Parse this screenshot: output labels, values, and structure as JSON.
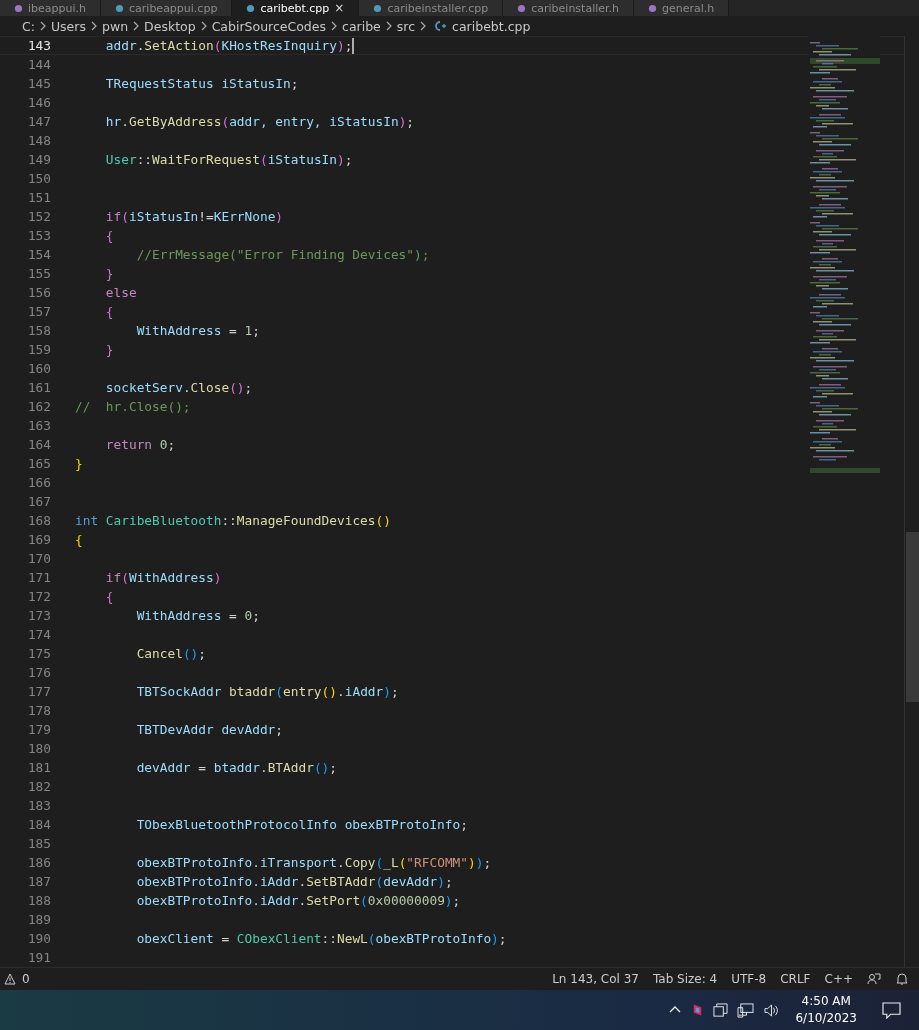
{
  "tabs": [
    {
      "label": "ibeappui.h",
      "selected": false,
      "kind": "header"
    },
    {
      "label": "caribeappui.cpp",
      "selected": false,
      "kind": "cpp"
    },
    {
      "label": "caribebt.cpp",
      "selected": true,
      "kind": "cpp",
      "close": "×"
    },
    {
      "label": "caribeinstaller.cpp",
      "selected": false,
      "kind": "cpp"
    },
    {
      "label": "caribeinstaller.h",
      "selected": false,
      "kind": "header"
    },
    {
      "label": "general.h",
      "selected": false,
      "kind": "header"
    }
  ],
  "breadcrumb": [
    "C:",
    "Users",
    "pwn",
    "Desktop",
    "CabirSourceCodes",
    "caribe",
    "src",
    "caribebt.cpp"
  ],
  "lines": [
    {
      "number": "143",
      "current": true,
      "tokens": [
        {
          "kind": "variable",
          "text": "    addr"
        },
        {
          "kind": "plain",
          "text": "."
        },
        {
          "kind": "function",
          "text": "SetAction"
        },
        {
          "kind": "bracket2",
          "text": "("
        },
        {
          "kind": "variable",
          "text": "KHostResInquiry"
        },
        {
          "kind": "bracket2",
          "text": ")"
        },
        {
          "kind": "plain",
          "text": ";"
        }
      ]
    },
    {
      "number": "144",
      "current": false
    },
    {
      "number": "145",
      "current": false,
      "tokens": [
        {
          "kind": "variable",
          "text": "    TRequestStatus iStatusIn"
        },
        {
          "kind": "plain",
          "text": ";"
        }
      ]
    },
    {
      "number": "146",
      "current": false
    },
    {
      "number": "147",
      "current": false,
      "tokens": [
        {
          "kind": "variable",
          "text": "    hr"
        },
        {
          "kind": "plain",
          "text": "."
        },
        {
          "kind": "function",
          "text": "GetByAddress"
        },
        {
          "kind": "bracket2",
          "text": "("
        },
        {
          "kind": "variable",
          "text": "addr, entry, iStatusIn"
        },
        {
          "kind": "bracket2",
          "text": ")"
        },
        {
          "kind": "plain",
          "text": ";"
        }
      ]
    },
    {
      "number": "148",
      "current": false
    },
    {
      "number": "149",
      "current": false,
      "tokens": [
        {
          "kind": "type",
          "text": "    User"
        },
        {
          "kind": "plain",
          "text": "::"
        },
        {
          "kind": "function",
          "text": "WaitForRequest"
        },
        {
          "kind": "bracket2",
          "text": "("
        },
        {
          "kind": "variable",
          "text": "iStatusIn"
        },
        {
          "kind": "bracket2",
          "text": ")"
        },
        {
          "kind": "plain",
          "text": ";"
        }
      ]
    },
    {
      "number": "150",
      "current": false
    },
    {
      "number": "151",
      "current": false
    },
    {
      "number": "152",
      "current": false,
      "tokens": [
        {
          "kind": "control",
          "text": "    if"
        },
        {
          "kind": "bracket2",
          "text": "("
        },
        {
          "kind": "variable",
          "text": "iStatusIn"
        },
        {
          "kind": "plain",
          "text": "!="
        },
        {
          "kind": "variable",
          "text": "KErrNone"
        },
        {
          "kind": "bracket2",
          "text": ")"
        }
      ]
    },
    {
      "number": "153",
      "current": false,
      "tokens": [
        {
          "kind": "bracket2",
          "text": "    {"
        }
      ]
    },
    {
      "number": "154",
      "current": false,
      "tokens": [
        {
          "kind": "comment",
          "text": "        //ErrMessage(\"Error Finding Devices\");"
        }
      ]
    },
    {
      "number": "155",
      "current": false,
      "tokens": [
        {
          "kind": "bracket2",
          "text": "    }"
        }
      ]
    },
    {
      "number": "156",
      "current": false,
      "tokens": [
        {
          "kind": "control",
          "text": "    else"
        }
      ]
    },
    {
      "number": "157",
      "current": false,
      "tokens": [
        {
          "kind": "bracket2",
          "text": "    {"
        }
      ]
    },
    {
      "number": "158",
      "current": false,
      "tokens": [
        {
          "kind": "variable",
          "text": "        WithAddress"
        },
        {
          "kind": "plain",
          "text": " = "
        },
        {
          "kind": "number",
          "text": "1"
        },
        {
          "kind": "plain",
          "text": ";"
        }
      ]
    },
    {
      "number": "159",
      "current": false,
      "tokens": [
        {
          "kind": "bracket2",
          "text": "    }"
        }
      ]
    },
    {
      "number": "160",
      "current": false
    },
    {
      "number": "161",
      "current": false,
      "tokens": [
        {
          "kind": "variable",
          "text": "    socketServ"
        },
        {
          "kind": "plain",
          "text": "."
        },
        {
          "kind": "function",
          "text": "Close"
        },
        {
          "kind": "bracket2",
          "text": "()"
        },
        {
          "kind": "plain",
          "text": ";"
        }
      ]
    },
    {
      "number": "162",
      "current": false,
      "tokens": [
        {
          "kind": "comment",
          "text": "//  hr.Close();"
        }
      ]
    },
    {
      "number": "163",
      "current": false
    },
    {
      "number": "164",
      "current": false,
      "tokens": [
        {
          "kind": "control",
          "text": "    return"
        },
        {
          "kind": "number",
          "text": " 0"
        },
        {
          "kind": "plain",
          "text": ";"
        }
      ]
    },
    {
      "number": "165",
      "current": false,
      "tokens": [
        {
          "kind": "bracket1",
          "text": "}"
        }
      ]
    },
    {
      "number": "166",
      "current": false
    },
    {
      "number": "167",
      "current": false
    },
    {
      "number": "168",
      "current": false,
      "tokens": [
        {
          "kind": "keyword",
          "text": "int"
        },
        {
          "kind": "type",
          "text": " CaribeBluetooth"
        },
        {
          "kind": "plain",
          "text": "::"
        },
        {
          "kind": "function",
          "text": "ManageFoundDevices"
        },
        {
          "kind": "bracket1",
          "text": "()"
        }
      ]
    },
    {
      "number": "169",
      "current": false,
      "tokens": [
        {
          "kind": "bracket1",
          "text": "{"
        }
      ]
    },
    {
      "number": "170",
      "current": false
    },
    {
      "number": "171",
      "current": false,
      "tokens": [
        {
          "kind": "control",
          "text": "    if"
        },
        {
          "kind": "bracket2",
          "text": "("
        },
        {
          "kind": "variable",
          "text": "WithAddress"
        },
        {
          "kind": "bracket2",
          "text": ")"
        }
      ]
    },
    {
      "number": "172",
      "current": false,
      "tokens": [
        {
          "kind": "bracket2",
          "text": "    {"
        }
      ]
    },
    {
      "number": "173",
      "current": false,
      "tokens": [
        {
          "kind": "variable",
          "text": "        WithAddress"
        },
        {
          "kind": "plain",
          "text": " = "
        },
        {
          "kind": "number",
          "text": "0"
        },
        {
          "kind": "plain",
          "text": ";"
        }
      ]
    },
    {
      "number": "174",
      "current": false
    },
    {
      "number": "175",
      "current": false,
      "tokens": [
        {
          "kind": "function",
          "text": "        Cancel"
        },
        {
          "kind": "bracket3",
          "text": "()"
        },
        {
          "kind": "plain",
          "text": ";"
        }
      ]
    },
    {
      "number": "176",
      "current": false
    },
    {
      "number": "177",
      "current": false,
      "tokens": [
        {
          "kind": "variable",
          "text": "        TBTSockAddr"
        },
        {
          "kind": "function",
          "text": " btaddr"
        },
        {
          "kind": "bracket3",
          "text": "("
        },
        {
          "kind": "function",
          "text": "entry"
        },
        {
          "kind": "bracket1",
          "text": "()"
        },
        {
          "kind": "plain",
          "text": "."
        },
        {
          "kind": "variable",
          "text": "iAddr"
        },
        {
          "kind": "bracket3",
          "text": ")"
        },
        {
          "kind": "plain",
          "text": ";"
        }
      ]
    },
    {
      "number": "178",
      "current": false
    },
    {
      "number": "179",
      "current": false,
      "tokens": [
        {
          "kind": "variable",
          "text": "        TBTDevAddr devAddr"
        },
        {
          "kind": "plain",
          "text": ";"
        }
      ]
    },
    {
      "number": "180",
      "current": false
    },
    {
      "number": "181",
      "current": false,
      "tokens": [
        {
          "kind": "variable",
          "text": "        devAddr"
        },
        {
          "kind": "plain",
          "text": " = "
        },
        {
          "kind": "variable",
          "text": "btaddr"
        },
        {
          "kind": "plain",
          "text": "."
        },
        {
          "kind": "function",
          "text": "BTAddr"
        },
        {
          "kind": "bracket3",
          "text": "()"
        },
        {
          "kind": "plain",
          "text": ";"
        }
      ]
    },
    {
      "number": "182",
      "current": false
    },
    {
      "number": "183",
      "current": false
    },
    {
      "number": "184",
      "current": false,
      "tokens": [
        {
          "kind": "variable",
          "text": "        TObexBluetoothProtocolInfo obexBTProtoInfo"
        },
        {
          "kind": "plain",
          "text": ";"
        }
      ]
    },
    {
      "number": "185",
      "current": false
    },
    {
      "number": "186",
      "current": false,
      "tokens": [
        {
          "kind": "variable",
          "text": "        obexBTProtoInfo.iTransport"
        },
        {
          "kind": "plain",
          "text": "."
        },
        {
          "kind": "function",
          "text": "Copy"
        },
        {
          "kind": "bracket3",
          "text": "("
        },
        {
          "kind": "function",
          "text": "_L"
        },
        {
          "kind": "bracket1",
          "text": "("
        },
        {
          "kind": "string",
          "text": "\"RFCOMM\""
        },
        {
          "kind": "bracket1",
          "text": ")"
        },
        {
          "kind": "bracket3",
          "text": ")"
        },
        {
          "kind": "plain",
          "text": ";"
        }
      ]
    },
    {
      "number": "187",
      "current": false,
      "tokens": [
        {
          "kind": "variable",
          "text": "        obexBTProtoInfo.iAddr"
        },
        {
          "kind": "plain",
          "text": "."
        },
        {
          "kind": "function",
          "text": "SetBTAddr"
        },
        {
          "kind": "bracket3",
          "text": "("
        },
        {
          "kind": "variable",
          "text": "devAddr"
        },
        {
          "kind": "bracket3",
          "text": ")"
        },
        {
          "kind": "plain",
          "text": ";"
        }
      ]
    },
    {
      "number": "188",
      "current": false,
      "tokens": [
        {
          "kind": "variable",
          "text": "        obexBTProtoInfo.iAddr"
        },
        {
          "kind": "plain",
          "text": "."
        },
        {
          "kind": "function",
          "text": "SetPort"
        },
        {
          "kind": "bracket3",
          "text": "("
        },
        {
          "kind": "number",
          "text": "0x00000009"
        },
        {
          "kind": "bracket3",
          "text": ")"
        },
        {
          "kind": "plain",
          "text": ";"
        }
      ]
    },
    {
      "number": "189",
      "current": false
    },
    {
      "number": "190",
      "current": false,
      "tokens": [
        {
          "kind": "variable",
          "text": "        obexClient"
        },
        {
          "kind": "plain",
          "text": " = "
        },
        {
          "kind": "type",
          "text": "CObexClient"
        },
        {
          "kind": "plain",
          "text": "::"
        },
        {
          "kind": "function",
          "text": "NewL"
        },
        {
          "kind": "bracket3",
          "text": "("
        },
        {
          "kind": "variable",
          "text": "obexBTProtoInfo"
        },
        {
          "kind": "bracket3",
          "text": ")"
        },
        {
          "kind": "plain",
          "text": ";"
        }
      ]
    },
    {
      "number": "191",
      "current": false
    }
  ],
  "status_bar": {
    "problems": "0",
    "position": "Ln 143, Col 37",
    "tab_size": "Tab Size: 4",
    "encoding": "UTF-8",
    "eol": "CRLF",
    "language": "C++"
  },
  "taskbar": {
    "time": "4:50 AM",
    "date": "6/10/2023"
  }
}
